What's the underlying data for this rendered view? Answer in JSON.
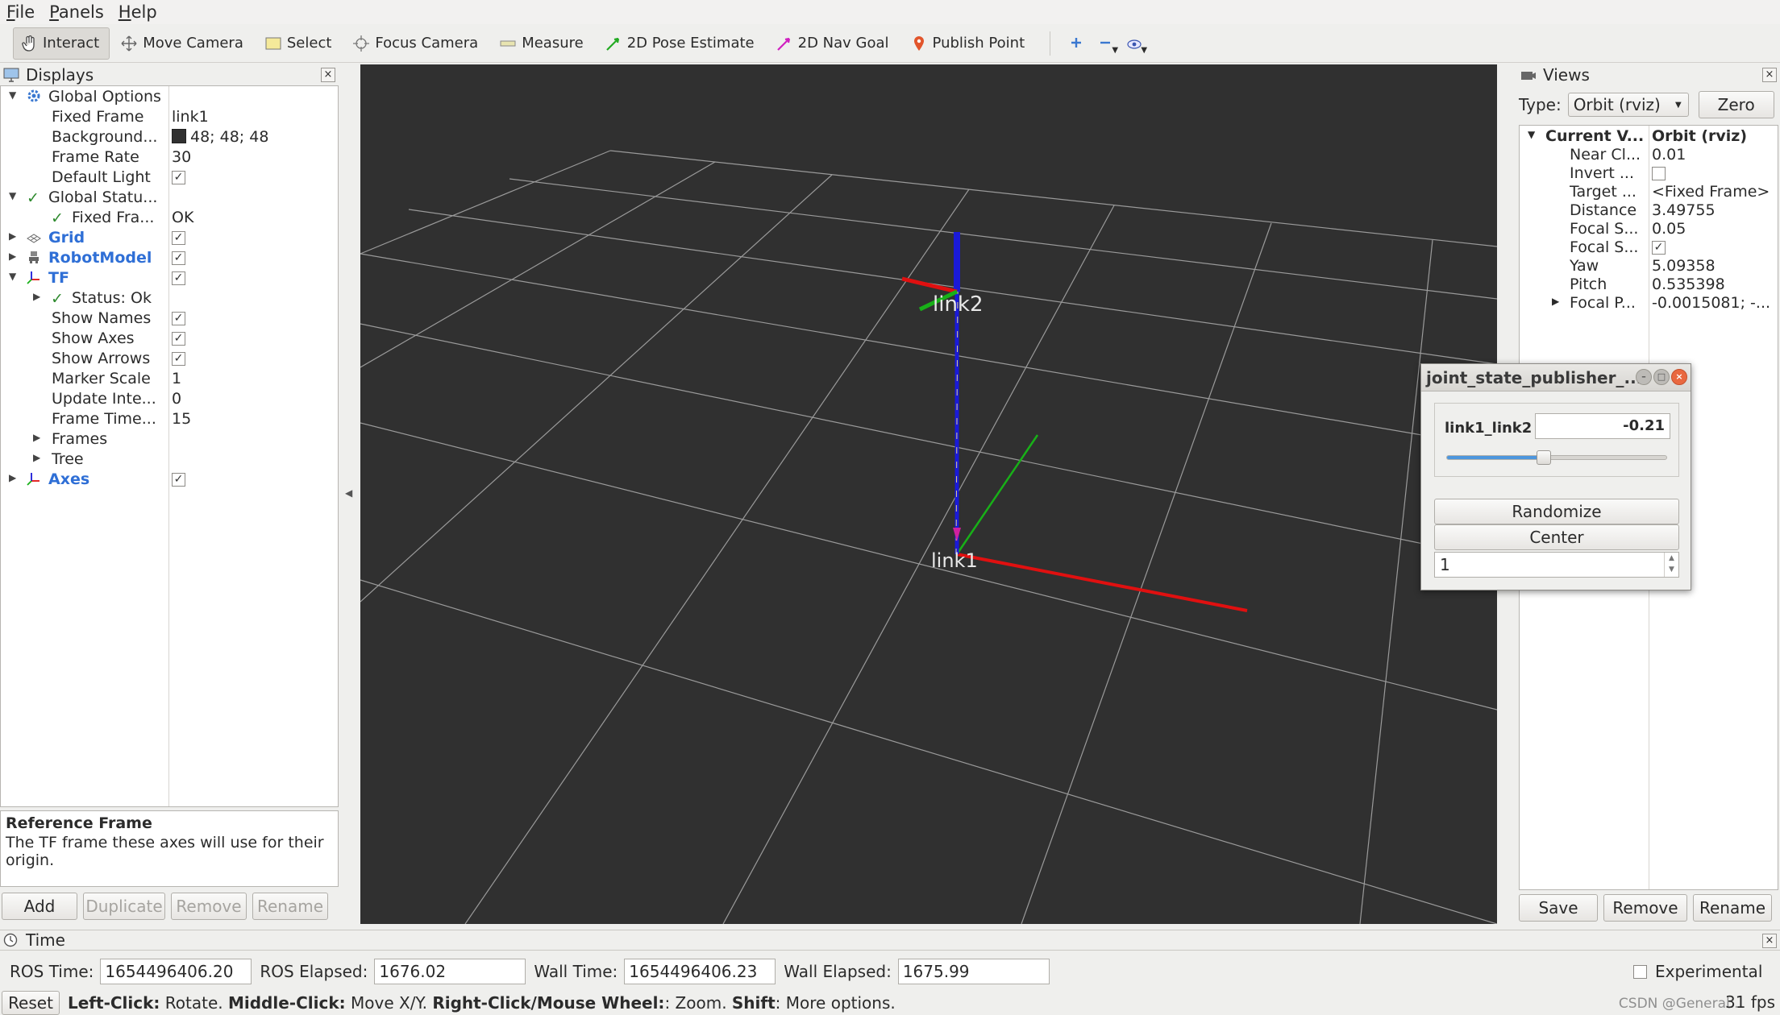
{
  "menu": [
    {
      "label": "File",
      "mnemonic": "F",
      "rest": "ile"
    },
    {
      "label": "Panels",
      "mnemonic": "P",
      "rest": "anels"
    },
    {
      "label": "Help",
      "mnemonic": "H",
      "rest": "elp"
    }
  ],
  "toolbar": {
    "interact": "Interact",
    "move_camera": "Move Camera",
    "select": "Select",
    "focus_camera": "Focus Camera",
    "measure": "Measure",
    "pose_estimate": "2D Pose Estimate",
    "nav_goal": "2D Nav Goal",
    "publish_point": "Publish Point"
  },
  "displays": {
    "title": "Displays",
    "rows": {
      "global_options": "Global Options",
      "fixed_frame": "Fixed Frame",
      "fixed_frame_val": "link1",
      "background": "Background...",
      "background_val": "48; 48; 48",
      "frame_rate": "Frame Rate",
      "frame_rate_val": "30",
      "default_light": "Default Light",
      "global_status": "Global Statu...",
      "fixed_fra": "Fixed Fra...",
      "fixed_fra_val": "OK",
      "grid": "Grid",
      "robot_model": "RobotModel",
      "tf": "TF",
      "status_ok": "Status: Ok",
      "show_names": "Show Names",
      "show_axes": "Show Axes",
      "show_arrows": "Show Arrows",
      "marker_scale": "Marker Scale",
      "marker_scale_val": "1",
      "update_inte": "Update Inte...",
      "update_inte_val": "0",
      "frame_time": "Frame Time...",
      "frame_time_val": "15",
      "frames": "Frames",
      "tree": "Tree",
      "axes": "Axes"
    },
    "desc_title": "Reference Frame",
    "desc_text": "The TF frame these axes will use for their origin.",
    "buttons": {
      "add": "Add",
      "duplicate": "Duplicate",
      "remove": "Remove",
      "rename": "Rename"
    }
  },
  "viewport": {
    "background": "#303030",
    "label_link1": "link1",
    "label_link2": "link2"
  },
  "views": {
    "title": "Views",
    "type_label": "Type:",
    "type_value": "Orbit (rviz)",
    "zero": "Zero",
    "rows": [
      {
        "name": "Current V...",
        "value": "Orbit (rviz)"
      },
      {
        "name": "Near Cl...",
        "value": "0.01"
      },
      {
        "name": "Invert ...",
        "value": ""
      },
      {
        "name": "Target ...",
        "value": "<Fixed Frame>"
      },
      {
        "name": "Distance",
        "value": "3.49755"
      },
      {
        "name": "Focal S...",
        "value": "0.05"
      },
      {
        "name": "Focal S...",
        "value": ""
      },
      {
        "name": "Yaw",
        "value": "5.09358"
      },
      {
        "name": "Pitch",
        "value": "0.535398"
      },
      {
        "name": "Focal P...",
        "value": "-0.0015081; -..."
      }
    ],
    "buttons": {
      "save": "Save",
      "remove": "Remove",
      "rename": "Rename"
    }
  },
  "joint_state_publisher": {
    "title": "joint_state_publisher_...",
    "joint_name": "link1_link2",
    "joint_value": "-0.21",
    "slider_fraction": 0.44,
    "randomize": "Randomize",
    "center": "Center",
    "spin_value": "1"
  },
  "time": {
    "title": "Time",
    "ros_time_label": "ROS Time:",
    "ros_time": "1654496406.20",
    "ros_elapsed_label": "ROS Elapsed:",
    "ros_elapsed": "1676.02",
    "wall_time_label": "Wall Time:",
    "wall_time": "1654496406.23",
    "wall_elapsed_label": "Wall Elapsed:",
    "wall_elapsed": "1675.99",
    "experimental": "Experimental"
  },
  "status": {
    "reset": "Reset",
    "left_click": "Left-Click:",
    "left_click_desc": " Rotate. ",
    "middle_click": "Middle-Click:",
    "middle_click_desc": " Move X/Y. ",
    "right_click": "Right-Click/Mouse Wheel:",
    "right_click_desc": ": Zoom. ",
    "shift": "Shift",
    "shift_desc": ": More options.",
    "fps": "31 fps",
    "watermark": "CSDN @General..."
  },
  "colors": {
    "axis_x": "#e01010",
    "axis_y": "#18b018",
    "axis_z": "#1a1ad8",
    "grid_line": "#a0a0a0",
    "link_blue": "#2f6fd6"
  }
}
